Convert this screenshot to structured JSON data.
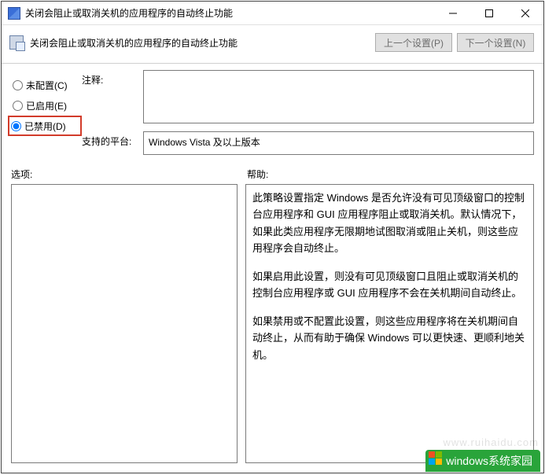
{
  "window": {
    "title": "关闭会阻止或取消关机的应用程序的自动终止功能"
  },
  "header": {
    "title": "关闭会阻止或取消关机的应用程序的自动终止功能",
    "prev_btn": "上一个设置(P)",
    "next_btn": "下一个设置(N)"
  },
  "radios": {
    "not_configured": "未配置(C)",
    "enabled": "已启用(E)",
    "disabled": "已禁用(D)",
    "selected": "disabled"
  },
  "labels": {
    "comment": "注释:",
    "platform": "支持的平台:",
    "options": "选项:",
    "help": "帮助:"
  },
  "comment_value": "",
  "platform_value": "Windows Vista 及以上版本",
  "options_content": "",
  "help_paragraphs": {
    "p1": "此策略设置指定 Windows 是否允许没有可见顶级窗口的控制台应用程序和 GUI 应用程序阻止或取消关机。默认情况下，如果此类应用程序无限期地试图取消或阻止关机，则这些应用程序会自动终止。",
    "p2": "如果启用此设置，则没有可见顶级窗口且阻止或取消关机的控制台应用程序或 GUI 应用程序不会在关机期间自动终止。",
    "p3": "如果禁用或不配置此设置，则这些应用程序将在关机期间自动终止，从而有助于确保 Windows 可以更快速、更顺利地关机。"
  },
  "watermark": {
    "text": "windows系统家园",
    "url": "www.ruihaidu.com"
  }
}
